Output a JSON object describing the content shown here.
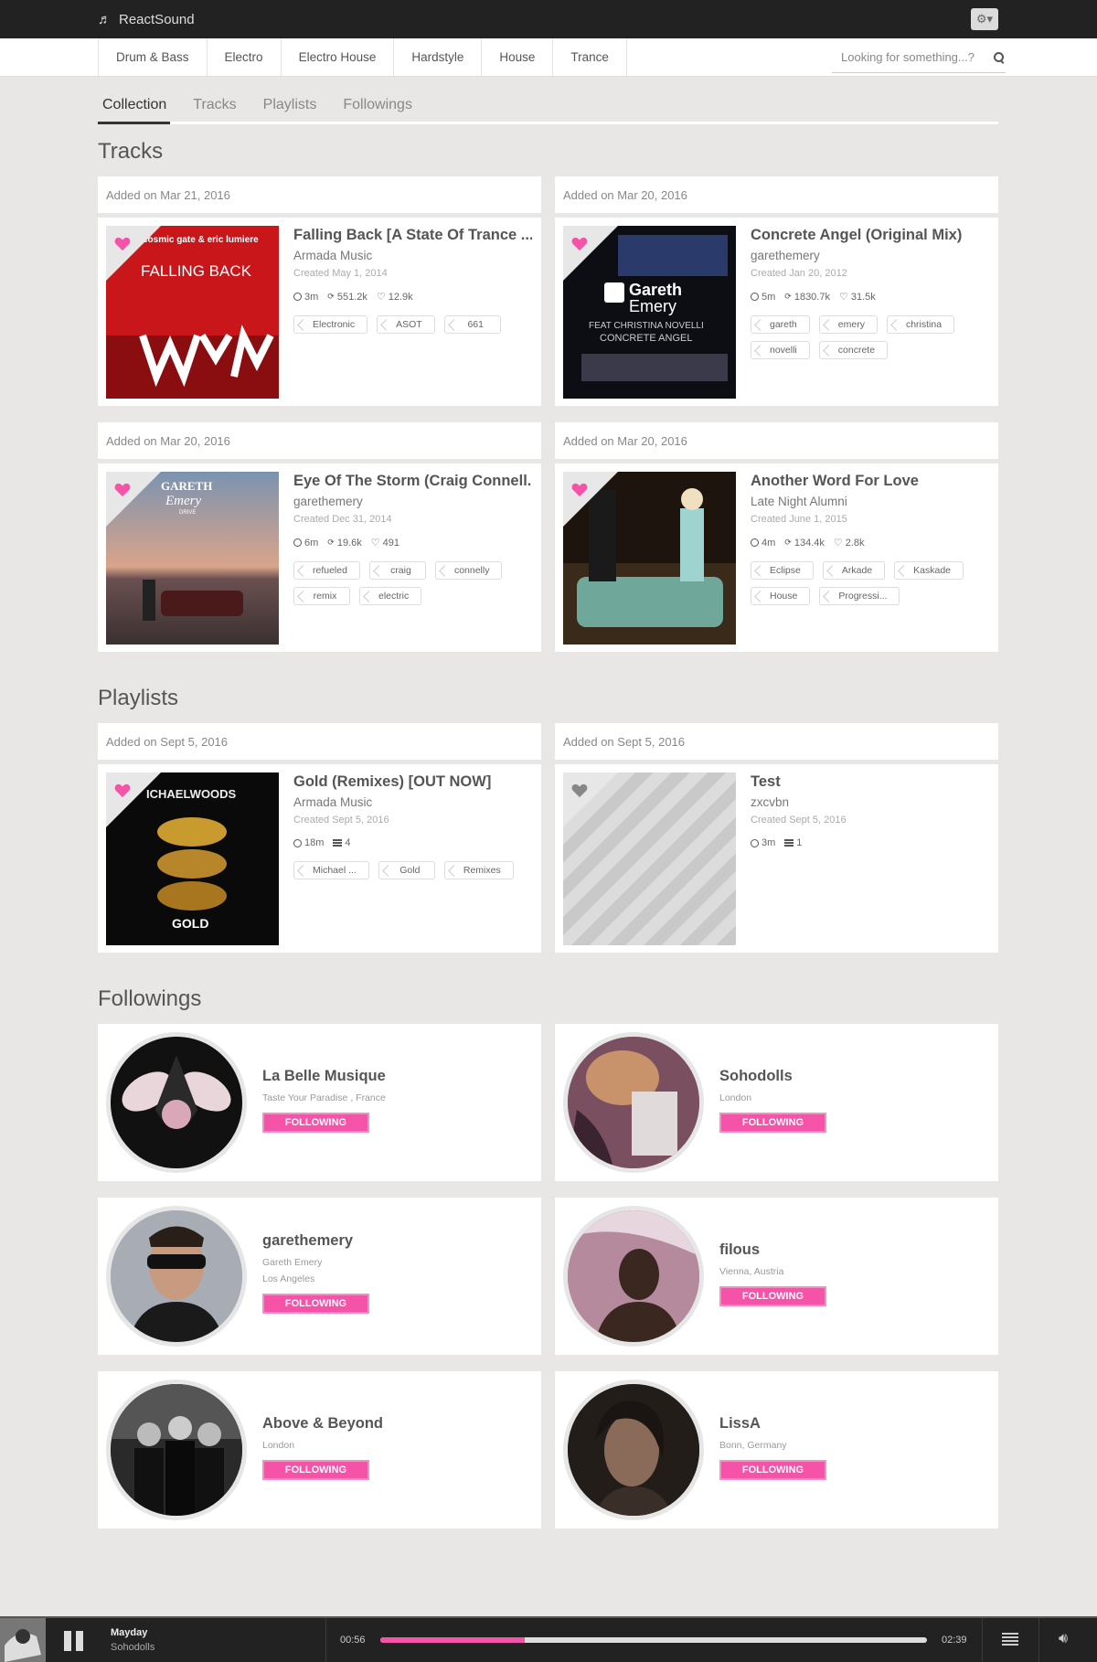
{
  "app": {
    "name": "ReactSound"
  },
  "genres": [
    "Drum & Bass",
    "Electro",
    "Electro House",
    "Hardstyle",
    "House",
    "Trance"
  ],
  "search": {
    "placeholder": "Looking for something...?"
  },
  "tabs": [
    "Collection",
    "Tracks",
    "Playlists",
    "Followings"
  ],
  "active_tab": "Collection",
  "sections": {
    "tracks": "Tracks",
    "playlists": "Playlists",
    "followings": "Followings"
  },
  "tracks": [
    {
      "added": "Added on Mar 21, 2016",
      "title": "Falling Back [A State Of Trance ...",
      "user": "Armada Music",
      "created": "Created May 1, 2014",
      "duration": "3m",
      "plays": "551.2k",
      "likes": "12.9k",
      "tags": [
        "Electronic",
        "ASOT",
        "661"
      ],
      "liked": true
    },
    {
      "added": "Added on Mar 20, 2016",
      "title": "Concrete Angel (Original Mix)",
      "user": "garethemery",
      "created": "Created Jan 20, 2012",
      "duration": "5m",
      "plays": "1830.7k",
      "likes": "31.5k",
      "tags": [
        "gareth",
        "emery",
        "christina",
        "novelli",
        "concrete"
      ],
      "liked": true
    },
    {
      "added": "Added on Mar 20, 2016",
      "title": "Eye Of The Storm (Craig Connell...",
      "user": "garethemery",
      "created": "Created Dec 31, 2014",
      "duration": "6m",
      "plays": "19.6k",
      "likes": "491",
      "tags": [
        "refueled",
        "craig",
        "connelly",
        "remix",
        "electric"
      ],
      "liked": true
    },
    {
      "added": "Added on Mar 20, 2016",
      "title": "Another Word For Love",
      "user": "Late Night Alumni",
      "created": "Created June 1, 2015",
      "duration": "4m",
      "plays": "134.4k",
      "likes": "2.8k",
      "tags": [
        "Eclipse",
        "Arkade",
        "Kaskade",
        "House",
        "Progressi..."
      ],
      "liked": true
    }
  ],
  "playlists": [
    {
      "added": "Added on Sept 5, 2016",
      "title": "Gold (Remixes) [OUT NOW]",
      "user": "Armada Music",
      "created": "Created Sept 5, 2016",
      "duration": "18m",
      "count": "4",
      "tags": [
        "Michael ...",
        "Gold",
        "Remixes"
      ],
      "liked": true
    },
    {
      "added": "Added on Sept 5, 2016",
      "title": "Test",
      "user": "zxcvbn",
      "created": "Created Sept 5, 2016",
      "duration": "3m",
      "count": "1",
      "tags": [],
      "liked": false
    }
  ],
  "followings": [
    {
      "name": "La Belle Musique",
      "lines": [
        "Taste Your Paradise , France"
      ],
      "button": "FOLLOWING"
    },
    {
      "name": "Sohodolls",
      "lines": [
        "London"
      ],
      "button": "FOLLOWING"
    },
    {
      "name": "garethemery",
      "lines": [
        "Gareth Emery",
        "Los Angeles"
      ],
      "button": "FOLLOWING"
    },
    {
      "name": "filous",
      "lines": [
        "Vienna, Austria"
      ],
      "button": "FOLLOWING"
    },
    {
      "name": "Above & Beyond",
      "lines": [
        "London"
      ],
      "button": "FOLLOWING"
    },
    {
      "name": "LissA",
      "lines": [
        "Bonn, Germany"
      ],
      "button": "FOLLOWING"
    }
  ],
  "player": {
    "title": "Mayday",
    "artist": "Sohodolls",
    "elapsed": "00:56",
    "total": "02:39",
    "progress": 0.265
  },
  "colors": {
    "accent": "#f453a8",
    "topbar": "#222222",
    "background": "#e8e7e5"
  }
}
